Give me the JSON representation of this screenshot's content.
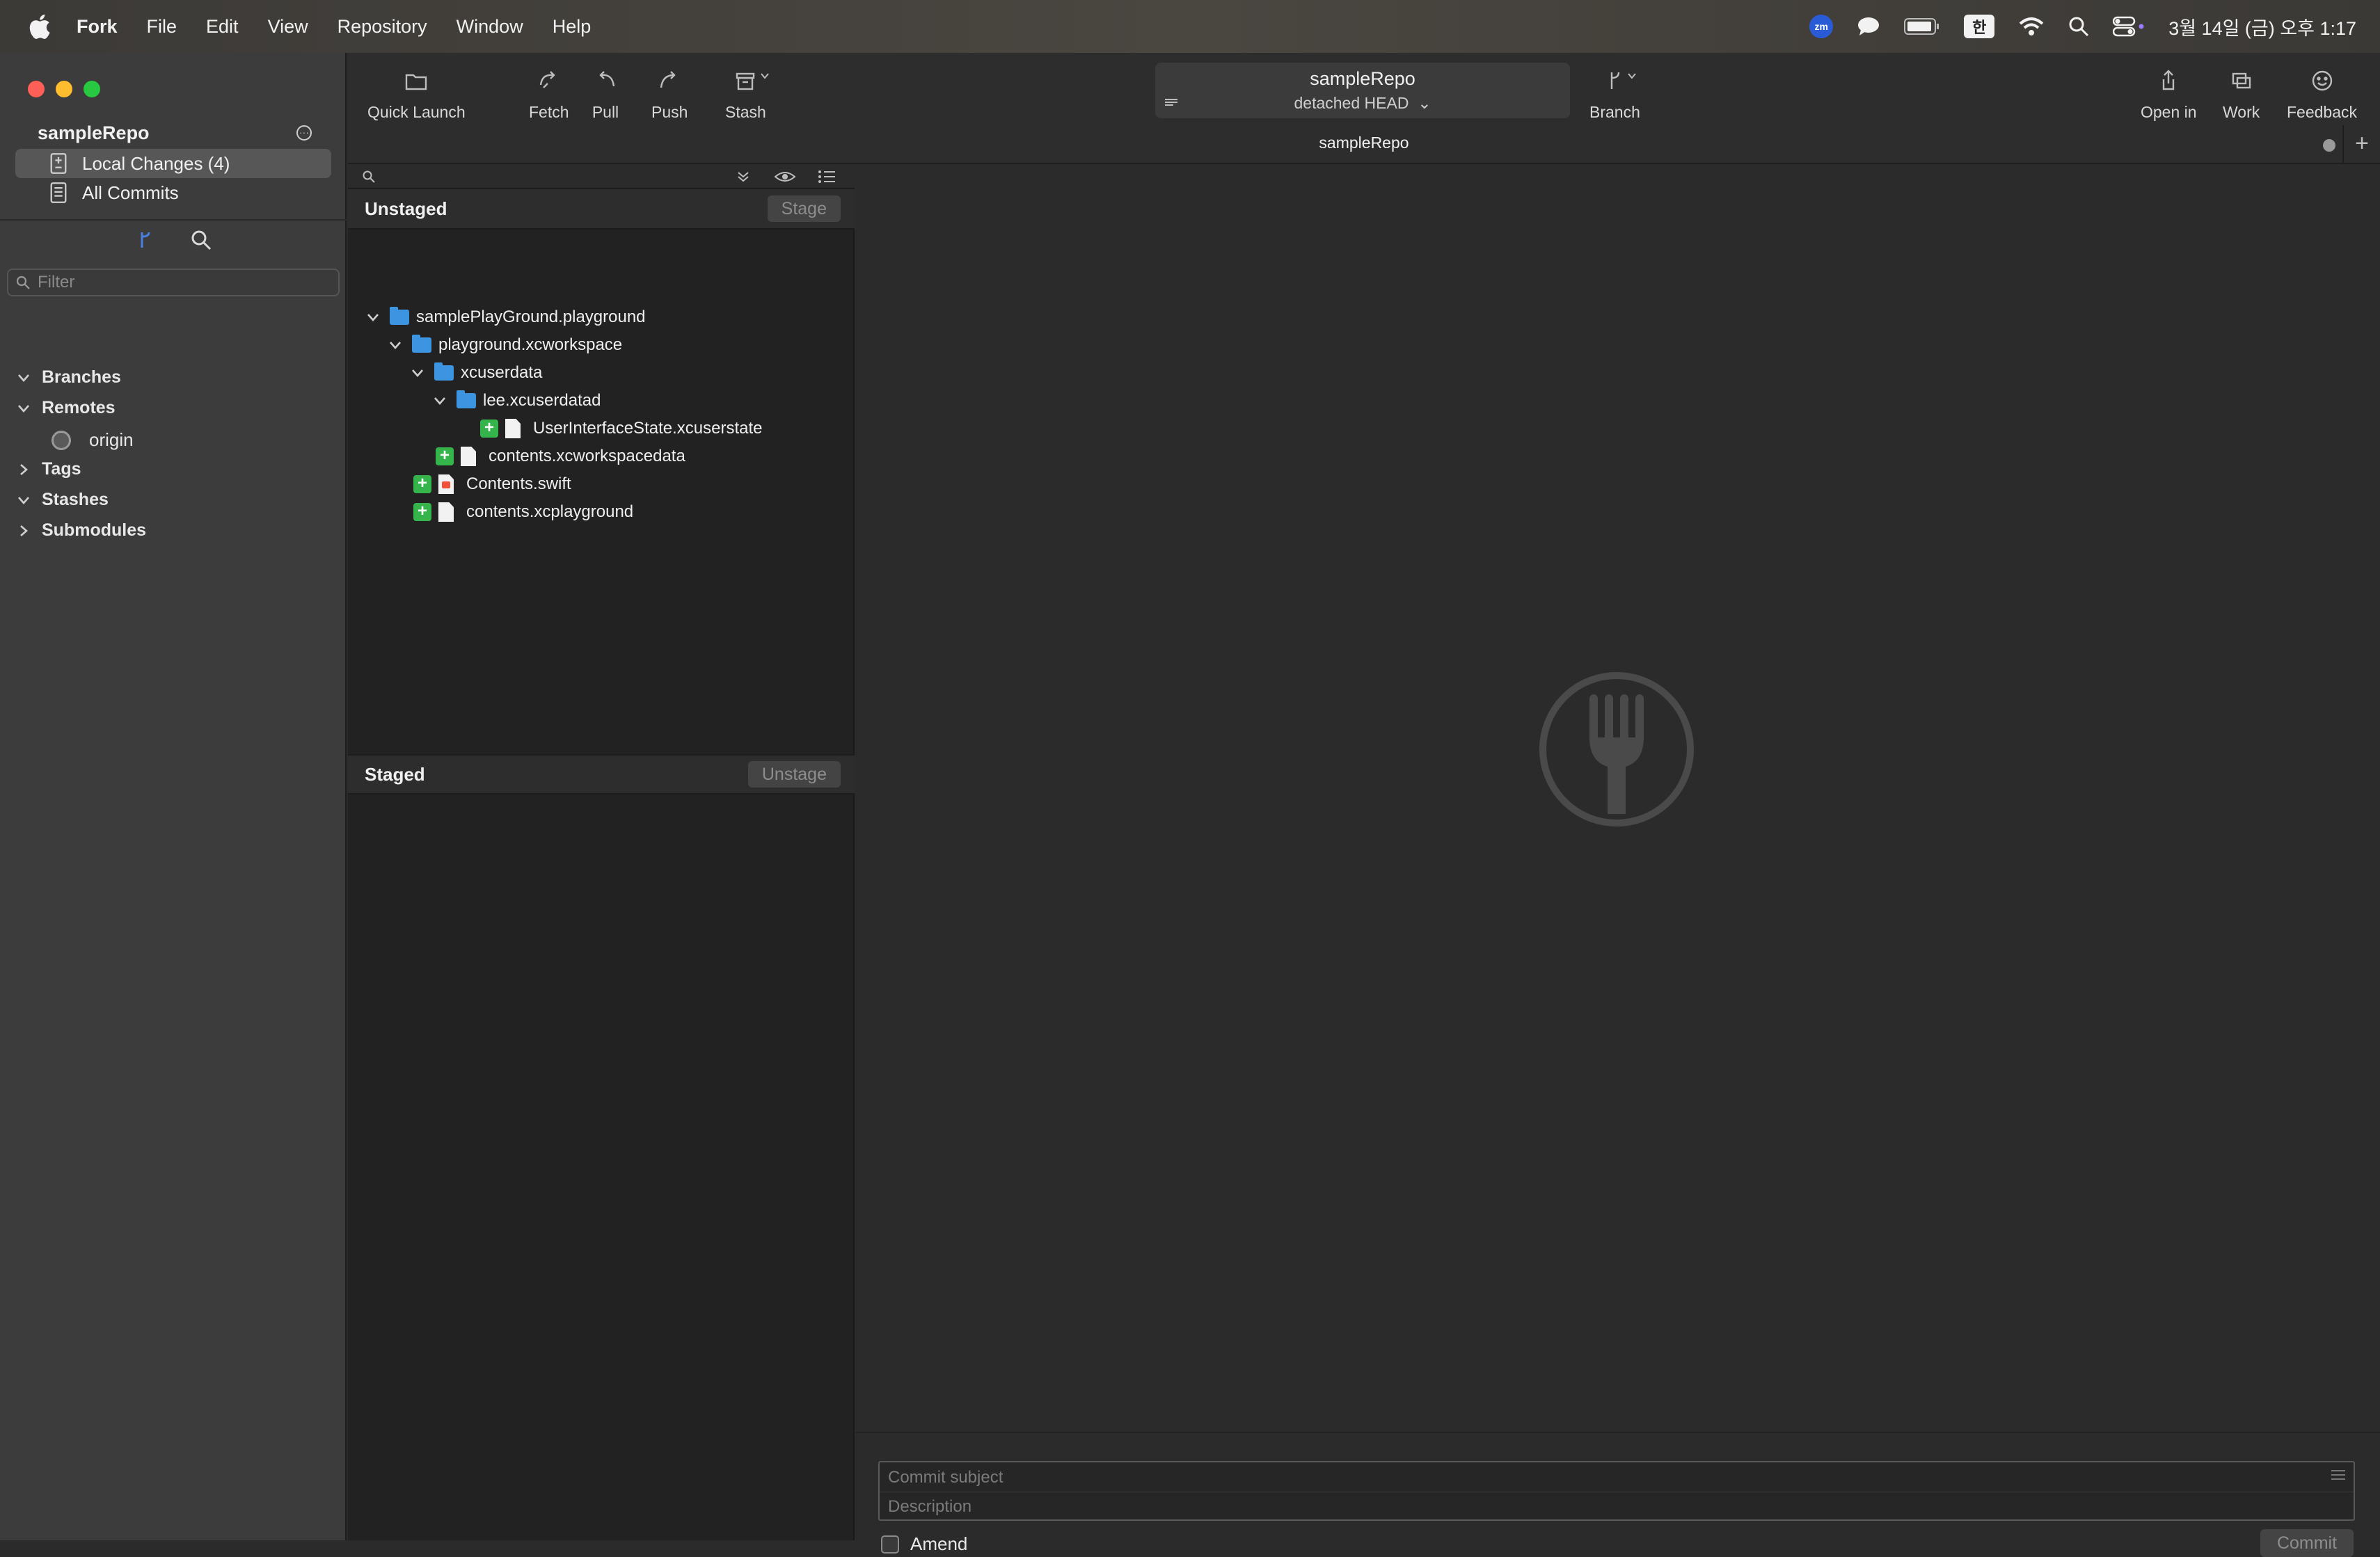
{
  "menubar": {
    "app_name": "Fork",
    "items": [
      "File",
      "Edit",
      "View",
      "Repository",
      "Window",
      "Help"
    ],
    "datetime": "3월 14일 (금) 오후 1:17",
    "zoom_badge": "zm",
    "input_method": "한"
  },
  "sidebar": {
    "repo_name": "sampleRepo",
    "nav": [
      {
        "label": "Local Changes (4)",
        "selected": true
      },
      {
        "label": "All Commits",
        "selected": false
      }
    ],
    "filter_placeholder": "Filter",
    "groups": {
      "branches": "Branches",
      "remotes": "Remotes",
      "origin": "origin",
      "tags": "Tags",
      "stashes": "Stashes",
      "submodules": "Submodules"
    }
  },
  "toolbar": {
    "quick_launch": "Quick Launch",
    "fetch": "Fetch",
    "pull": "Pull",
    "push": "Push",
    "stash": "Stash",
    "repo_title": "sampleRepo",
    "head_state": "detached HEAD",
    "branch": "Branch",
    "open_in": "Open in",
    "work": "Work",
    "feedback": "Feedback",
    "tab_title": "sampleRepo"
  },
  "unstaged": {
    "label": "Unstaged",
    "button": "Stage",
    "files": [
      {
        "name": "samplePlayGround.playground",
        "type": "folder"
      },
      {
        "name": "playground.xcworkspace",
        "type": "folder"
      },
      {
        "name": "xcuserdata",
        "type": "folder"
      },
      {
        "name": "lee.xcuserdatad",
        "type": "folder"
      },
      {
        "name": "UserInterfaceState.xcuserstate",
        "type": "added-file"
      },
      {
        "name": "contents.xcworkspacedata",
        "type": "added-file"
      },
      {
        "name": "Contents.swift",
        "type": "added-swift"
      },
      {
        "name": "contents.xcplayground",
        "type": "added-file"
      }
    ]
  },
  "staged": {
    "label": "Staged",
    "button": "Unstage"
  },
  "commit": {
    "subject_placeholder": "Commit subject",
    "description_placeholder": "Description",
    "amend_label": "Amend",
    "commit_button": "Commit"
  },
  "colors": {
    "accent_folder": "#3d94e0",
    "added_badge": "#34b44a",
    "selected_row": "#575757"
  }
}
